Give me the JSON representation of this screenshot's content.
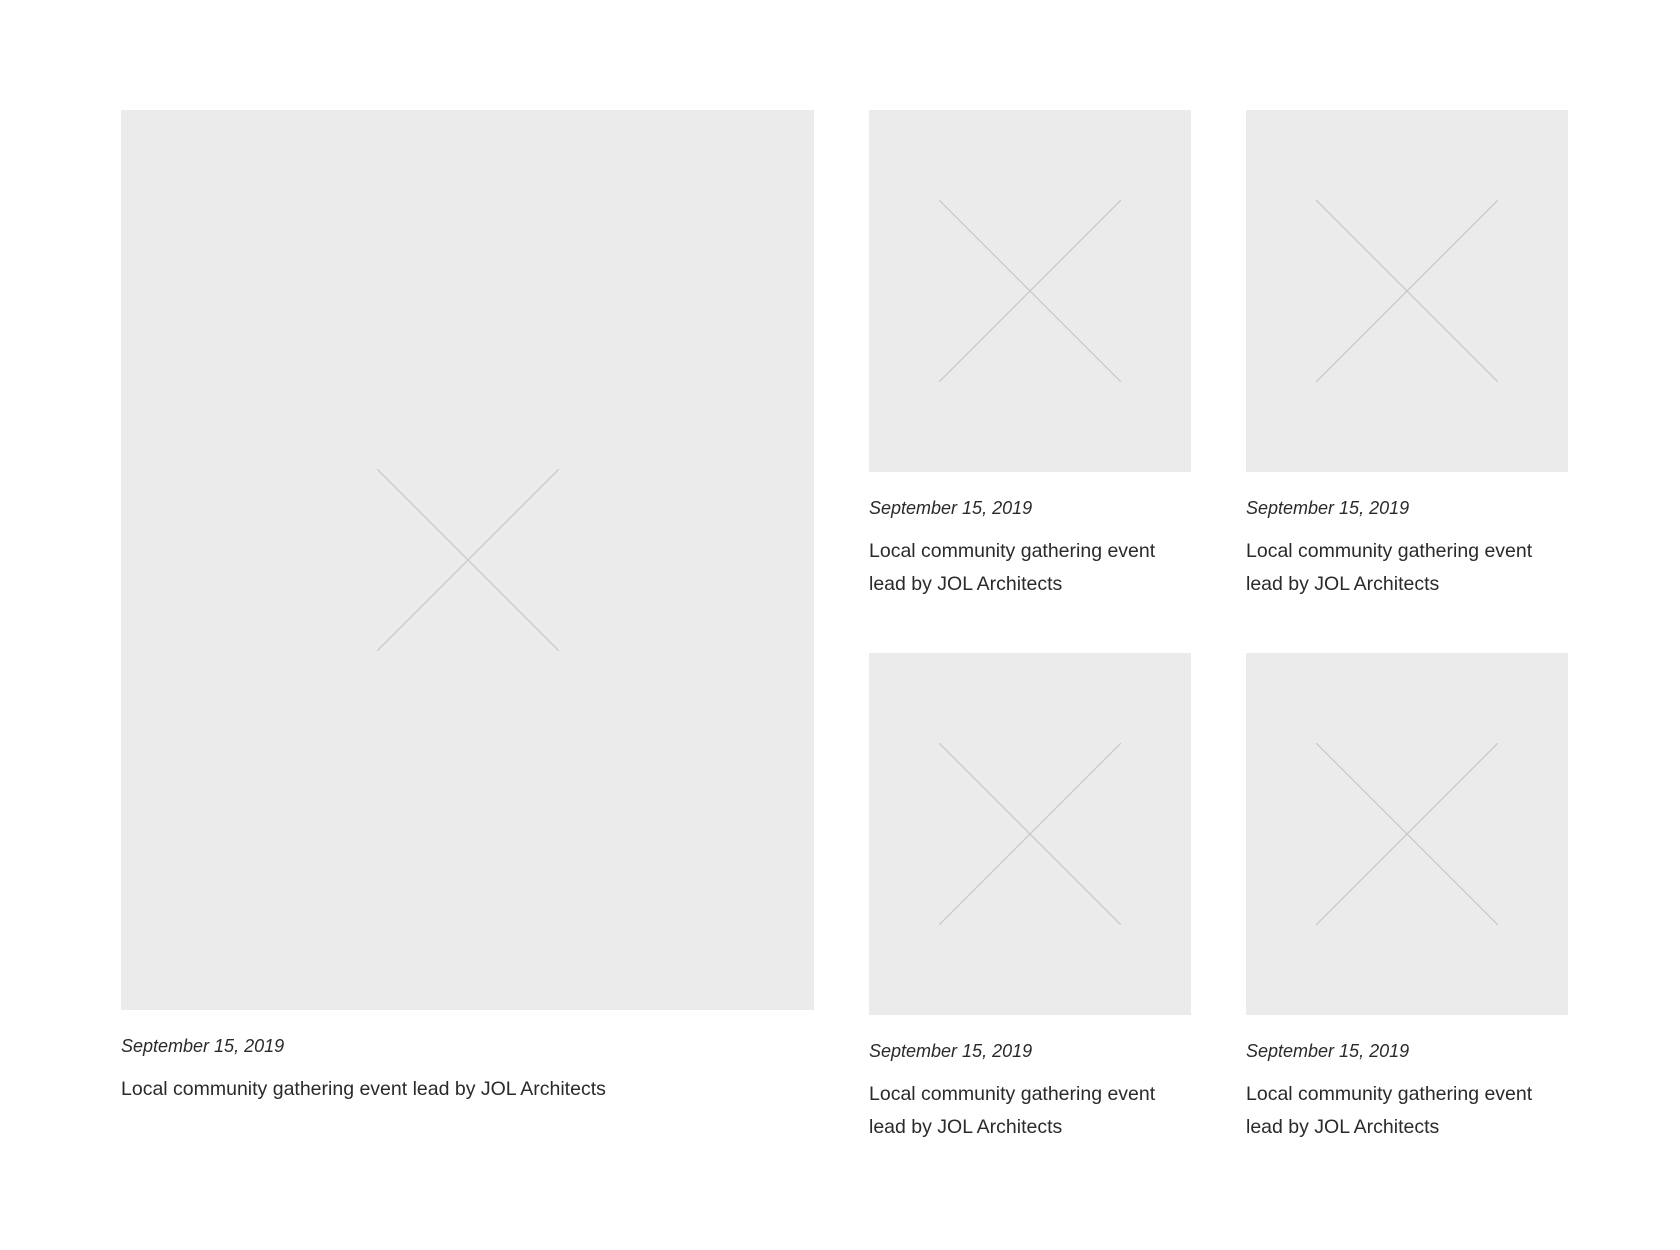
{
  "cards": [
    {
      "date": "September 15, 2019",
      "caption": "Local community gathering event lead by JOL Architects",
      "image_icon": "image-placeholder-x-icon"
    },
    {
      "date": "September 15, 2019",
      "caption": "Local community gathering event lead by JOL Architects",
      "image_icon": "image-placeholder-x-icon"
    },
    {
      "date": "September 15, 2019",
      "caption": "Local community gathering event lead by JOL Architects",
      "image_icon": "image-placeholder-x-icon"
    },
    {
      "date": "September 15, 2019",
      "caption": "Local community gathering event lead by JOL Architects",
      "image_icon": "image-placeholder-x-icon"
    },
    {
      "date": "September 15, 2019",
      "caption": "Local community gathering event lead by JOL Architects",
      "image_icon": "image-placeholder-x-icon"
    }
  ],
  "colors": {
    "placeholder_bg": "#ebebeb",
    "placeholder_cross": "#c8c8c8",
    "text": "#2a2a2a",
    "page_bg": "#ffffff"
  }
}
